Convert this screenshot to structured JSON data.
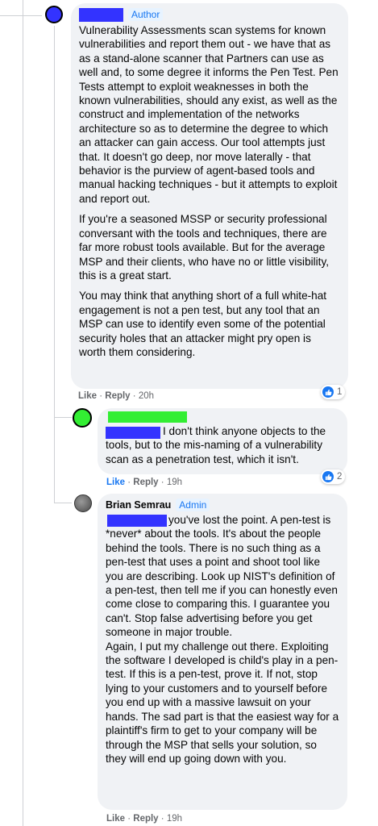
{
  "colors": {
    "redact_blue": "#3333ff",
    "redact_green": "#33ee33",
    "bubble_bg": "#f0f2f5",
    "badge_bg": "#e7f3ff",
    "badge_text": "#1877f2",
    "like_blue": "#1877f2"
  },
  "comment1": {
    "badge": "Author",
    "paragraphs": [
      "Vulnerability Assessments scan systems for known vulnerabilities and report them out - we have that as as a stand-alone scanner that Partners can use as well and, to some degree it informs the Pen Test. Pen Tests attempt to exploit weaknesses in both the known vulnerabilities, should any exist, as well as the construct and implementation of the networks architecture so as to determine the degree to which an attacker can gain access. Our tool attempts just that. It doesn't go deep, nor move laterally - that behavior is the purview of agent-based tools and manual hacking techniques - but it attempts to exploit and report out.",
      "If you're a seasoned MSSP or security professional conversant with the tools and techniques, there are far more robust tools available. But for the average MSP and their clients, who have no or little visibility, this is a great start.",
      "You may think that anything short of a full white-hat engagement is not a pen test, but any tool that an MSP can use to identify even some of the potential security holes that an attacker might pry open is worth them considering."
    ],
    "like": "Like",
    "reply": "Reply",
    "time": "20h",
    "reaction_count": "1"
  },
  "comment2": {
    "text": "I don't think anyone objects to the tools, but to the mis-naming of a vulnerability scan as a penetration test, which it isn't.",
    "like": "Like",
    "reply": "Reply",
    "time": "19h",
    "reaction_count": "2"
  },
  "comment3": {
    "author": "Brian Semrau",
    "badge": "Admin",
    "paragraphs": [
      "you've lost the point. A pen-test is *never* about the tools. It's about the people behind the tools. There is no such thing as a pen-test that uses a point and shoot tool like you are describing. Look up NIST's definition of a pen-test, then tell me if you can honestly even come close to comparing this. I guarantee you can't. Stop false advertising before you get someone in major trouble.",
      "Again, I put my challenge out there. Exploiting the software I developed is child's play in a pen-test. If this is a pen-test, prove it. If not, stop lying to your customers and to yourself before you end up with a massive lawsuit on your hands. The sad part is that the easiest way for a plaintiff's firm to get to your company will be through the MSP that sells your solution, so they will end up going down with you."
    ],
    "like": "Like",
    "reply": "Reply",
    "time": "19h"
  },
  "separator": "·",
  "icons": {
    "like_reaction": "thumbs-up-icon"
  }
}
